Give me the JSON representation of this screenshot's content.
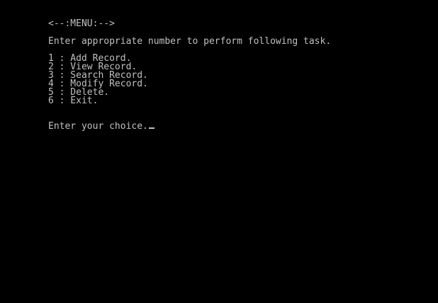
{
  "console": {
    "menu_title": "<--:MENU:-->",
    "instruction": "Enter appropriate number to perform following task.",
    "menu_items": [
      "1 : Add Record.",
      "2 : View Record.",
      "3 : Search Record.",
      "4 : Modify Record.",
      "5 : Delete.",
      "6 : Exit."
    ],
    "prompt": "Enter your choice.",
    "text_color": "#c0c0c0",
    "background_color": "#000000"
  }
}
